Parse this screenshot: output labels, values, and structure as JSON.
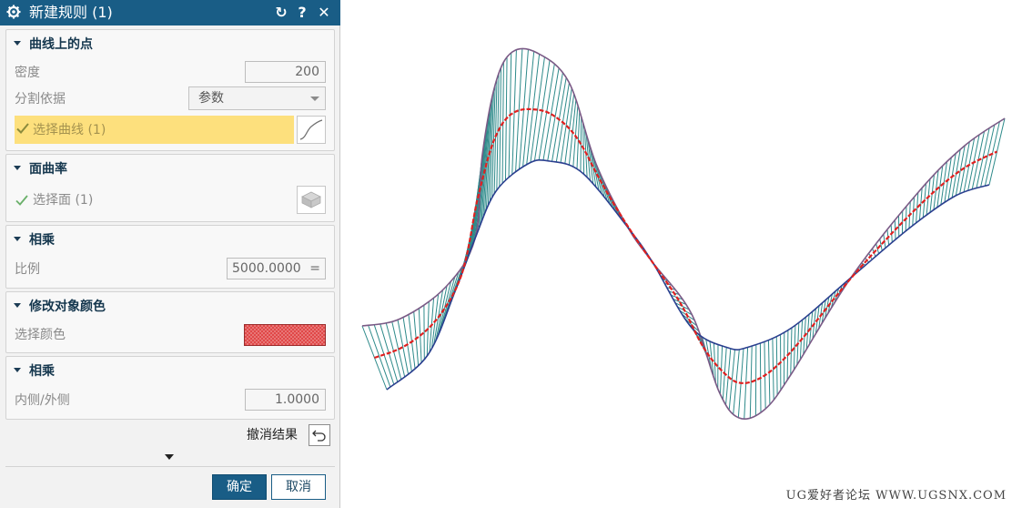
{
  "dialog": {
    "title": "新建规则 (1)",
    "title_buttons": [
      "refresh-icon",
      "help-icon",
      "close-icon"
    ],
    "help_label": "?",
    "close_label": "✕",
    "refresh_label": "↻"
  },
  "groups": {
    "points_on_curve": {
      "header": "曲线上的点",
      "density_label": "密度",
      "density_value": "200",
      "split_label": "分割依据",
      "split_value": "参数",
      "select_curve_label": "选择曲线 (1)"
    },
    "face_curvature": {
      "header": "面曲率",
      "select_face_label": "选择面 (1)"
    },
    "multiply1": {
      "header": "相乘",
      "scale_label": "比例",
      "scale_value": "5000.0000",
      "equals_symbol": "="
    },
    "modify_color": {
      "header": "修改对象颜色",
      "select_color_label": "选择颜色",
      "color": "#e04848"
    },
    "multiply2": {
      "header": "相乘",
      "inout_label": "内侧/外侧",
      "inout_value": "1.0000"
    }
  },
  "undo_label": "撤消结果",
  "ok_label": "确定",
  "cancel_label": "取消",
  "watermark": "UG爱好者论坛 WWW.UGSNX.COM",
  "colors": {
    "accent": "#195d86",
    "highlight": "#fde07d",
    "boundary": "#2a3f8f",
    "porcupine": "#2e8a8a",
    "center": "#e02020"
  }
}
